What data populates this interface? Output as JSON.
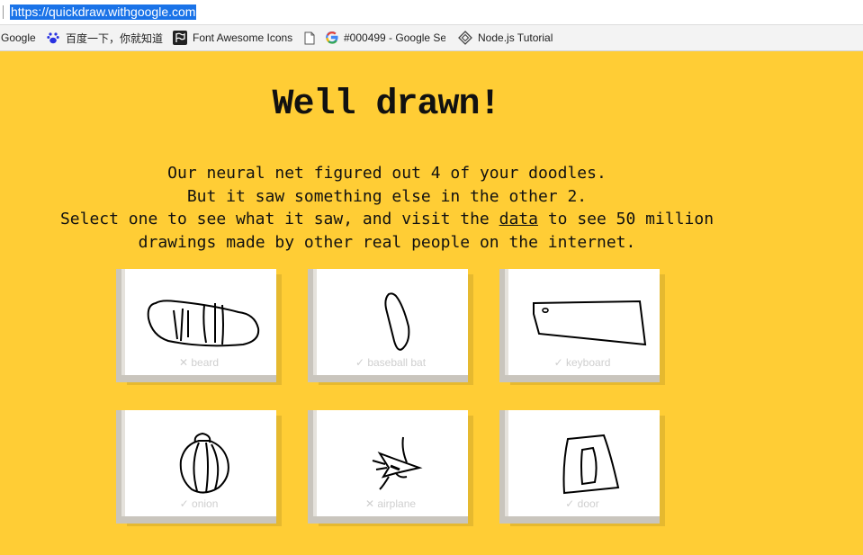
{
  "browser": {
    "url": "https://quickdraw.withgoogle.com",
    "bookmarks": [
      {
        "label": "Google",
        "icon": "none"
      },
      {
        "label": "百度一下，你就知道",
        "icon": "baidu-paw-icon"
      },
      {
        "label": "Font Awesome Icons",
        "icon": "font-awesome-flag-icon"
      },
      {
        "label": "",
        "icon": "document-icon"
      },
      {
        "label": "#000499 - Google Se",
        "icon": "google-g-icon"
      },
      {
        "label": "Node.js Tutorial",
        "icon": "diamond-icon"
      }
    ]
  },
  "page": {
    "title": "Well drawn!",
    "lines": [
      "Our neural net figured out 4 of your doodles.",
      "But it saw something else in the other 2."
    ],
    "line3_prefix": "Select one to see what it saw, and visit the",
    "data_link": "data",
    "line3_suffix": "to see 50 million",
    "line4": "drawings made by other real people on the internet."
  },
  "doodles": [
    {
      "label": "✕ beard",
      "correct": false,
      "drawing": "beard"
    },
    {
      "label": "✓ baseball bat",
      "correct": true,
      "drawing": "baseball-bat"
    },
    {
      "label": "✓ keyboard",
      "correct": true,
      "drawing": "keyboard"
    },
    {
      "label": "✓ onion",
      "correct": true,
      "drawing": "onion"
    },
    {
      "label": "✕ airplane",
      "correct": false,
      "drawing": "airplane"
    },
    {
      "label": "✓ door",
      "correct": true,
      "drawing": "door"
    }
  ],
  "colors": {
    "background": "#ffcd35",
    "url_highlight": "#1a73e8"
  }
}
